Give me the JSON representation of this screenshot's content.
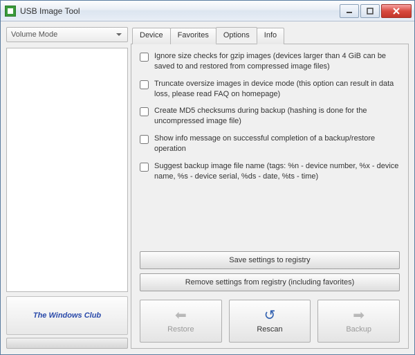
{
  "window": {
    "title": "USB Image Tool"
  },
  "left": {
    "mode_selected": "Volume Mode",
    "logo_text": "The Windows Club"
  },
  "tabs": {
    "t0": "Device",
    "t1": "Favorites",
    "t2": "Options",
    "t3": "Info"
  },
  "options": {
    "o0": "Ignore size checks for gzip images (devices larger than 4 GiB can be saved to and restored from compressed image files)",
    "o1": "Truncate oversize images in device mode (this option can result in data loss, please read FAQ on homepage)",
    "o2": "Create MD5 checksums during backup (hashing is done for the uncompressed image file)",
    "o3": "Show info message on successful completion of a backup/restore operation",
    "o4": "Suggest backup image file name (tags: %n - device number, %x - device name, %s - device serial, %ds - date, %ts - time)"
  },
  "registry": {
    "save": "Save settings to registry",
    "remove": "Remove settings from registry (including favorites)"
  },
  "actions": {
    "restore": "Restore",
    "rescan": "Rescan",
    "backup": "Backup"
  }
}
